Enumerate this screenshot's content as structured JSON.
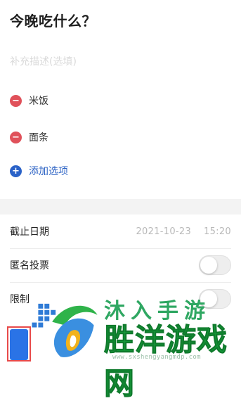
{
  "poll": {
    "title": "今晚吃什么？",
    "description_placeholder": "补充描述(选填)",
    "options": [
      {
        "label": "米饭",
        "icon": "remove-circle-icon"
      },
      {
        "label": "面条",
        "icon": "remove-circle-icon"
      }
    ],
    "add_option_label": "添加选项"
  },
  "settings": {
    "deadline": {
      "label": "截止日期",
      "date": "2021-10-23",
      "time": "15:20"
    },
    "anonymous": {
      "label": "匿名投票",
      "on": false
    },
    "limit": {
      "label": "限制",
      "on": false
    }
  },
  "watermark": {
    "top_text": "沐入手游",
    "main_text": "胜洋游戏网",
    "url": "www.sxshengyangmdp.com"
  },
  "colors": {
    "remove": "#e0515a",
    "add": "#2a62c8",
    "primary_button": "#2a73e6",
    "watermark_green": "#169c3b"
  }
}
